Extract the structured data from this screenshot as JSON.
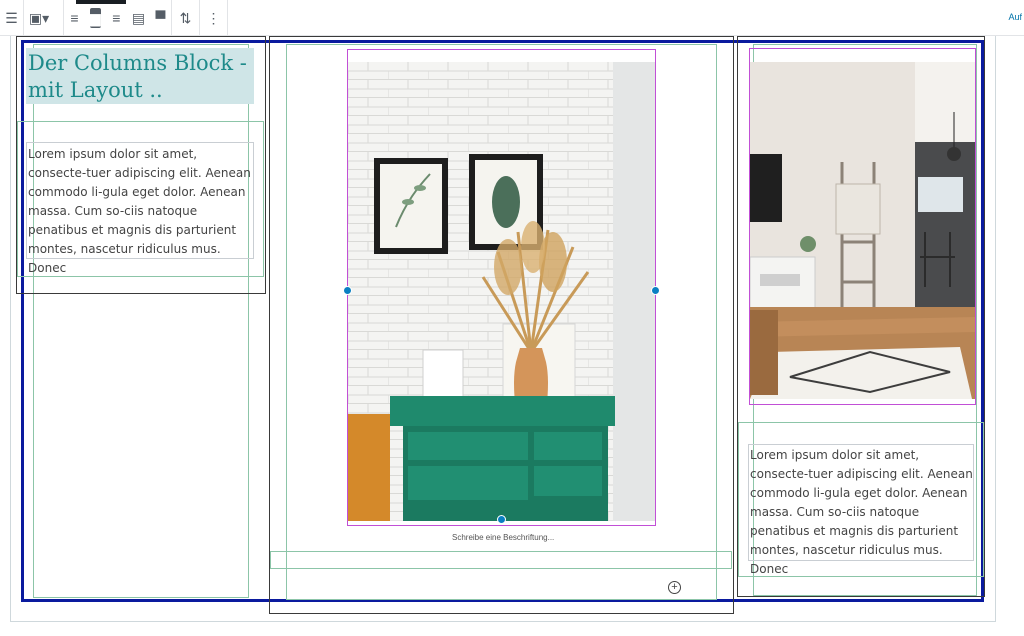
{
  "toolbar": {
    "buttons": [
      {
        "name": "block-navigation-icon"
      },
      {
        "name": "image-block-icon"
      },
      {
        "name": "align-left-icon"
      },
      {
        "name": "align-center-icon",
        "active": true
      },
      {
        "name": "align-right-icon"
      },
      {
        "name": "align-wide-icon"
      },
      {
        "name": "align-full-icon"
      },
      {
        "name": "replace-icon"
      },
      {
        "name": "more-options-icon"
      }
    ],
    "right_label": "Auf"
  },
  "content": {
    "heading": "Der Columns Block - mit Layout ..",
    "paragraph_left": "Lorem ipsum dolor sit amet, consecte-tuer adipiscing elit. Aenean commodo li-gula eget dolor. Aenean massa. Cum so-ciis natoque penatibus et magnis  dis parturient montes, nascetur ridiculus mus. Donec",
    "paragraph_right": "Lorem ipsum dolor sit amet, consecte-tuer adipiscing elit. Aenean commodo li-gula eget dolor. Aenean massa. Cum so-ciis natoque penatibus et magnis  dis parturient montes, nascetur ridiculus mus. Donec",
    "caption_placeholder": "Schreibe eine Beschriftung..."
  },
  "colors": {
    "selection_blue": "#0a1a9e",
    "heading_teal": "#1e8a8a",
    "heading_bg": "#cfe5e7",
    "handle_blue": "#0a7fc2",
    "image_outline": "#c14fd6",
    "column_outline": "#8cc5a8"
  }
}
